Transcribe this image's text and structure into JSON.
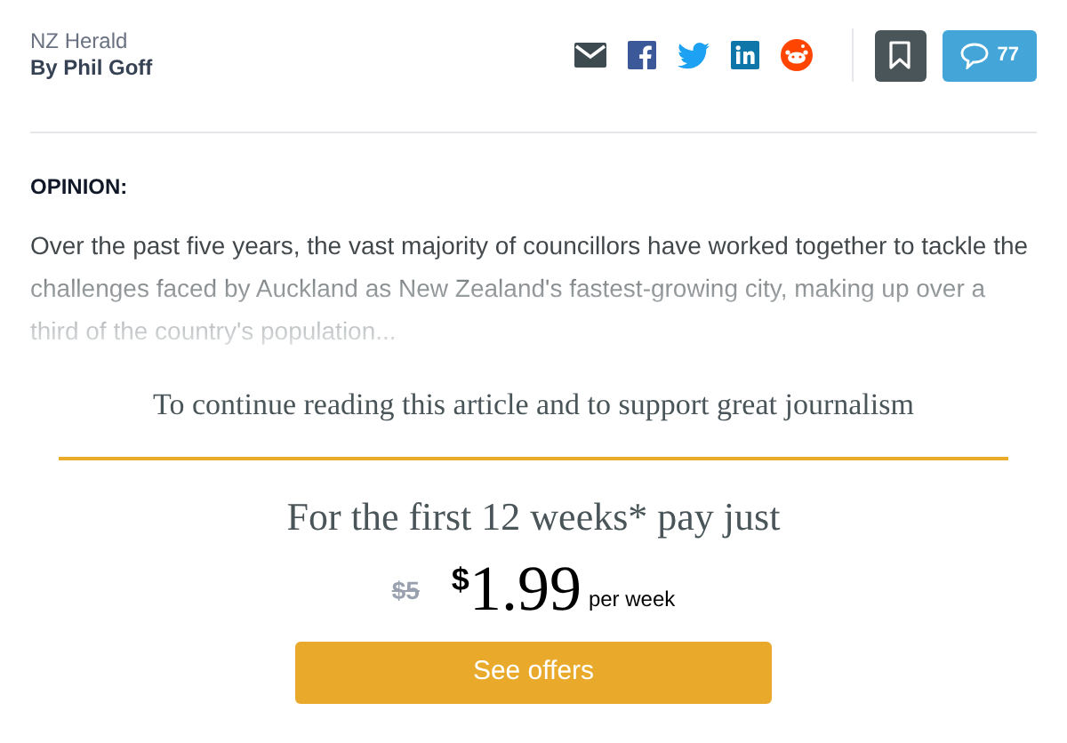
{
  "header": {
    "source": "NZ Herald",
    "byline": "By Phil Goff",
    "comments_count": "77"
  },
  "article": {
    "label": "OPINION:",
    "teaser": "Over the past five years, the vast majority of councillors have worked together to tackle the challenges faced by Auckland as New Zealand's fastest-growing city, making up over a third of the country's population..."
  },
  "paywall": {
    "heading": "To continue reading this article and to support great journalism",
    "offer": "For the first 12 weeks* pay just",
    "old_price": "$5",
    "currency": "$",
    "price": "1.99",
    "period": "per week",
    "button": "See offers"
  }
}
